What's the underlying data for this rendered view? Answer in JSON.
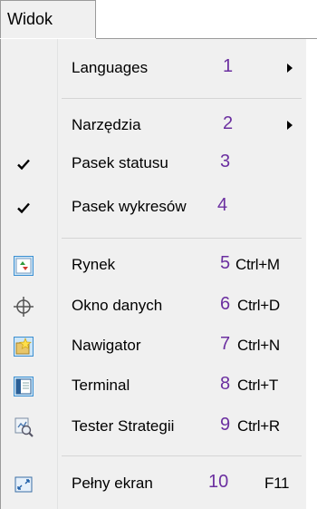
{
  "menubar": {
    "title": "Widok"
  },
  "items": [
    {
      "label": "Languages",
      "num": "1",
      "shortcut": "",
      "submenu": true,
      "checked": false,
      "icon": ""
    },
    {
      "label": "Narzędzia",
      "num": "2",
      "shortcut": "",
      "submenu": true,
      "checked": false,
      "icon": ""
    },
    {
      "label": "Pasek statusu",
      "num": "3",
      "shortcut": "",
      "submenu": false,
      "checked": true,
      "icon": "check-icon"
    },
    {
      "label": "Pasek wykresów",
      "num": "4",
      "shortcut": "",
      "submenu": false,
      "checked": true,
      "icon": "check-icon"
    },
    {
      "label": "Rynek",
      "num": "5",
      "shortcut": "Ctrl+M",
      "submenu": false,
      "checked": false,
      "icon": "market-watch-icon"
    },
    {
      "label": "Okno danych",
      "num": "6",
      "shortcut": "Ctrl+D",
      "submenu": false,
      "checked": false,
      "icon": "crosshair-icon"
    },
    {
      "label": "Nawigator",
      "num": "7",
      "shortcut": "Ctrl+N",
      "submenu": false,
      "checked": false,
      "icon": "navigator-stars-icon"
    },
    {
      "label": "Terminal",
      "num": "8",
      "shortcut": "Ctrl+T",
      "submenu": false,
      "checked": false,
      "icon": "terminal-icon"
    },
    {
      "label": "Tester Strategii",
      "num": "9",
      "shortcut": "Ctrl+R",
      "submenu": false,
      "checked": false,
      "icon": "strategy-tester-icon"
    },
    {
      "label": "Pełny ekran",
      "num": "10",
      "shortcut": "F11",
      "submenu": false,
      "checked": false,
      "icon": "fullscreen-icon"
    }
  ],
  "colors": {
    "number_accent": "#6b2fa0",
    "menu_bg": "#f0f0f0",
    "highlight_border": "#3c8fd1"
  }
}
